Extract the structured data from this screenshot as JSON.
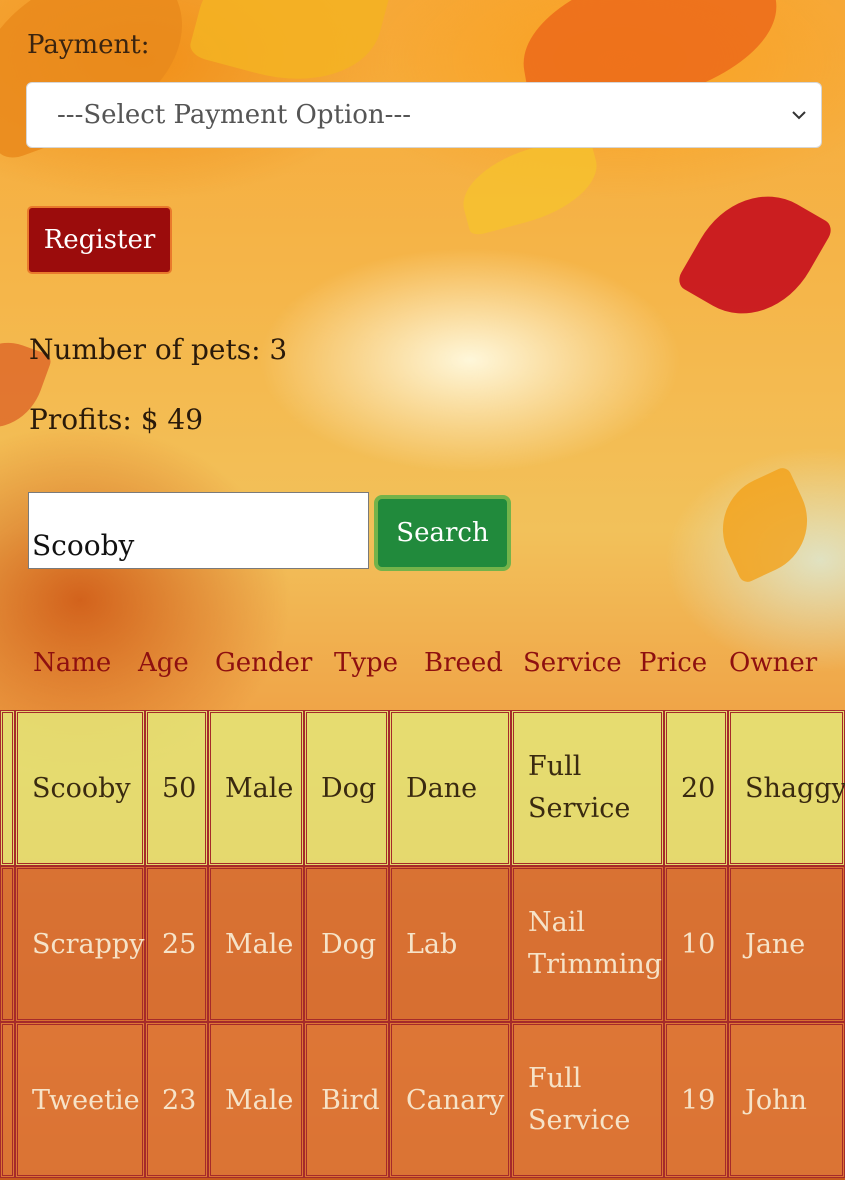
{
  "form": {
    "payment_label": "Payment:",
    "payment_select_value": "---Select Payment Option---",
    "register_label": "Register"
  },
  "stats": {
    "pets_count_text": "Number of pets: 3",
    "profits_text": "Profits: $ 49"
  },
  "search": {
    "input_value": "Scooby",
    "button_label": "Search"
  },
  "table": {
    "headers": [
      "Name",
      "Age",
      "Gender",
      "Type",
      "Breed",
      "Service",
      "Price",
      "Owner"
    ],
    "rows": [
      [
        "Scooby",
        "50",
        "Male",
        "Dog",
        "Dane",
        "Full Service",
        "20",
        "Shaggy"
      ],
      [
        "Scrappy",
        "25",
        "Male",
        "Dog",
        "Lab",
        "Nail Trimming",
        "10",
        "Jane"
      ],
      [
        "Tweetie",
        "23",
        "Male",
        "Bird",
        "Canary",
        "Full Service",
        "19",
        "John"
      ]
    ]
  },
  "colors": {
    "register_bg": "#9b0c0c",
    "search_bg": "#218a3c",
    "header_text": "#8e1010",
    "border": "#a52a2a"
  },
  "icons": {
    "select_caret": "chevron-down-icon"
  }
}
